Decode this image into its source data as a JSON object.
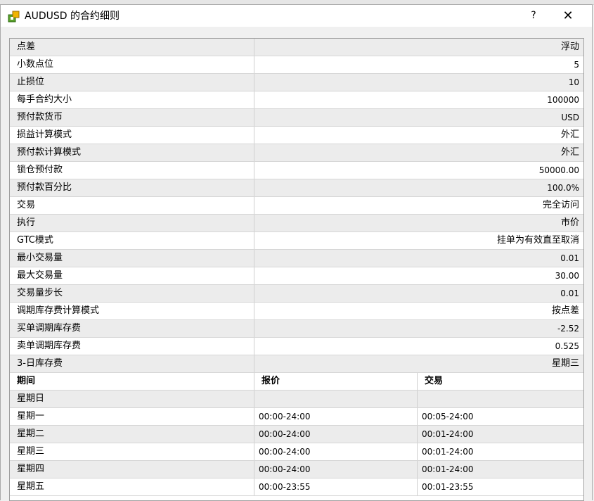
{
  "window": {
    "title": "AUDUSD 的合约细则",
    "help": "?",
    "close": "✕"
  },
  "properties": [
    {
      "key": "点差",
      "value": "浮动"
    },
    {
      "key": "小数点位",
      "value": "5"
    },
    {
      "key": "止损位",
      "value": "10"
    },
    {
      "key": "每手合约大小",
      "value": "100000"
    },
    {
      "key": "预付款货币",
      "value": "USD"
    },
    {
      "key": "损益计算模式",
      "value": "外汇"
    },
    {
      "key": "预付款计算模式",
      "value": "外汇"
    },
    {
      "key": "锁仓预付款",
      "value": "50000.00"
    },
    {
      "key": "预付款百分比",
      "value": "100.0%"
    },
    {
      "key": "交易",
      "value": "完全访问"
    },
    {
      "key": "执行",
      "value": "市价"
    },
    {
      "key": "GTC模式",
      "value": "挂单为有效直至取消"
    },
    {
      "key": "最小交易量",
      "value": "0.01"
    },
    {
      "key": "最大交易量",
      "value": "30.00"
    },
    {
      "key": "交易量步长",
      "value": "0.01"
    },
    {
      "key": "调期库存费计算模式",
      "value": "按点差"
    },
    {
      "key": "买单调期库存费",
      "value": "-2.52"
    },
    {
      "key": "卖单调期库存费",
      "value": "0.525"
    },
    {
      "key": "3-日库存费",
      "value": "星期三"
    }
  ],
  "sessions": {
    "headers": [
      "期间",
      "报价",
      "交易"
    ],
    "rows": [
      {
        "day": "星期日",
        "quote": "",
        "trade": ""
      },
      {
        "day": "星期一",
        "quote": "00:00-24:00",
        "trade": "00:05-24:00"
      },
      {
        "day": "星期二",
        "quote": "00:00-24:00",
        "trade": "00:01-24:00"
      },
      {
        "day": "星期三",
        "quote": "00:00-24:00",
        "trade": "00:01-24:00"
      },
      {
        "day": "星期四",
        "quote": "00:00-24:00",
        "trade": "00:01-24:00"
      },
      {
        "day": "星期五",
        "quote": "00:00-23:55",
        "trade": "00:01-23:55"
      }
    ]
  },
  "icons": {
    "app": "contract-box-icon"
  },
  "colors": {
    "alt_row": "#ececec",
    "window_bg": "#f0f0f0"
  }
}
